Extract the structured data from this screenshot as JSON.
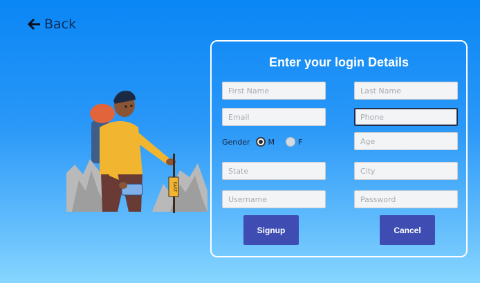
{
  "nav": {
    "back_label": "Back"
  },
  "form": {
    "title": "Enter your login Details",
    "first_name_placeholder": "First Name",
    "last_name_placeholder": "Last Name",
    "email_placeholder": "Email",
    "phone_placeholder": "Phone",
    "gender_label": "Gender",
    "gender_options": [
      {
        "label": "M",
        "selected": true
      },
      {
        "label": "F",
        "selected": false
      }
    ],
    "age_placeholder": "Age",
    "state_placeholder": "State",
    "city_placeholder": "City",
    "username_placeholder": "Username",
    "password_placeholder": "Password",
    "signup_label": "Signup",
    "cancel_label": "Cancel"
  },
  "illustration": {
    "signpost_text": "EAST"
  },
  "colors": {
    "accent_button": "#3f4db3",
    "background_top": "#0a86f5",
    "background_bottom": "#86d6ff"
  }
}
